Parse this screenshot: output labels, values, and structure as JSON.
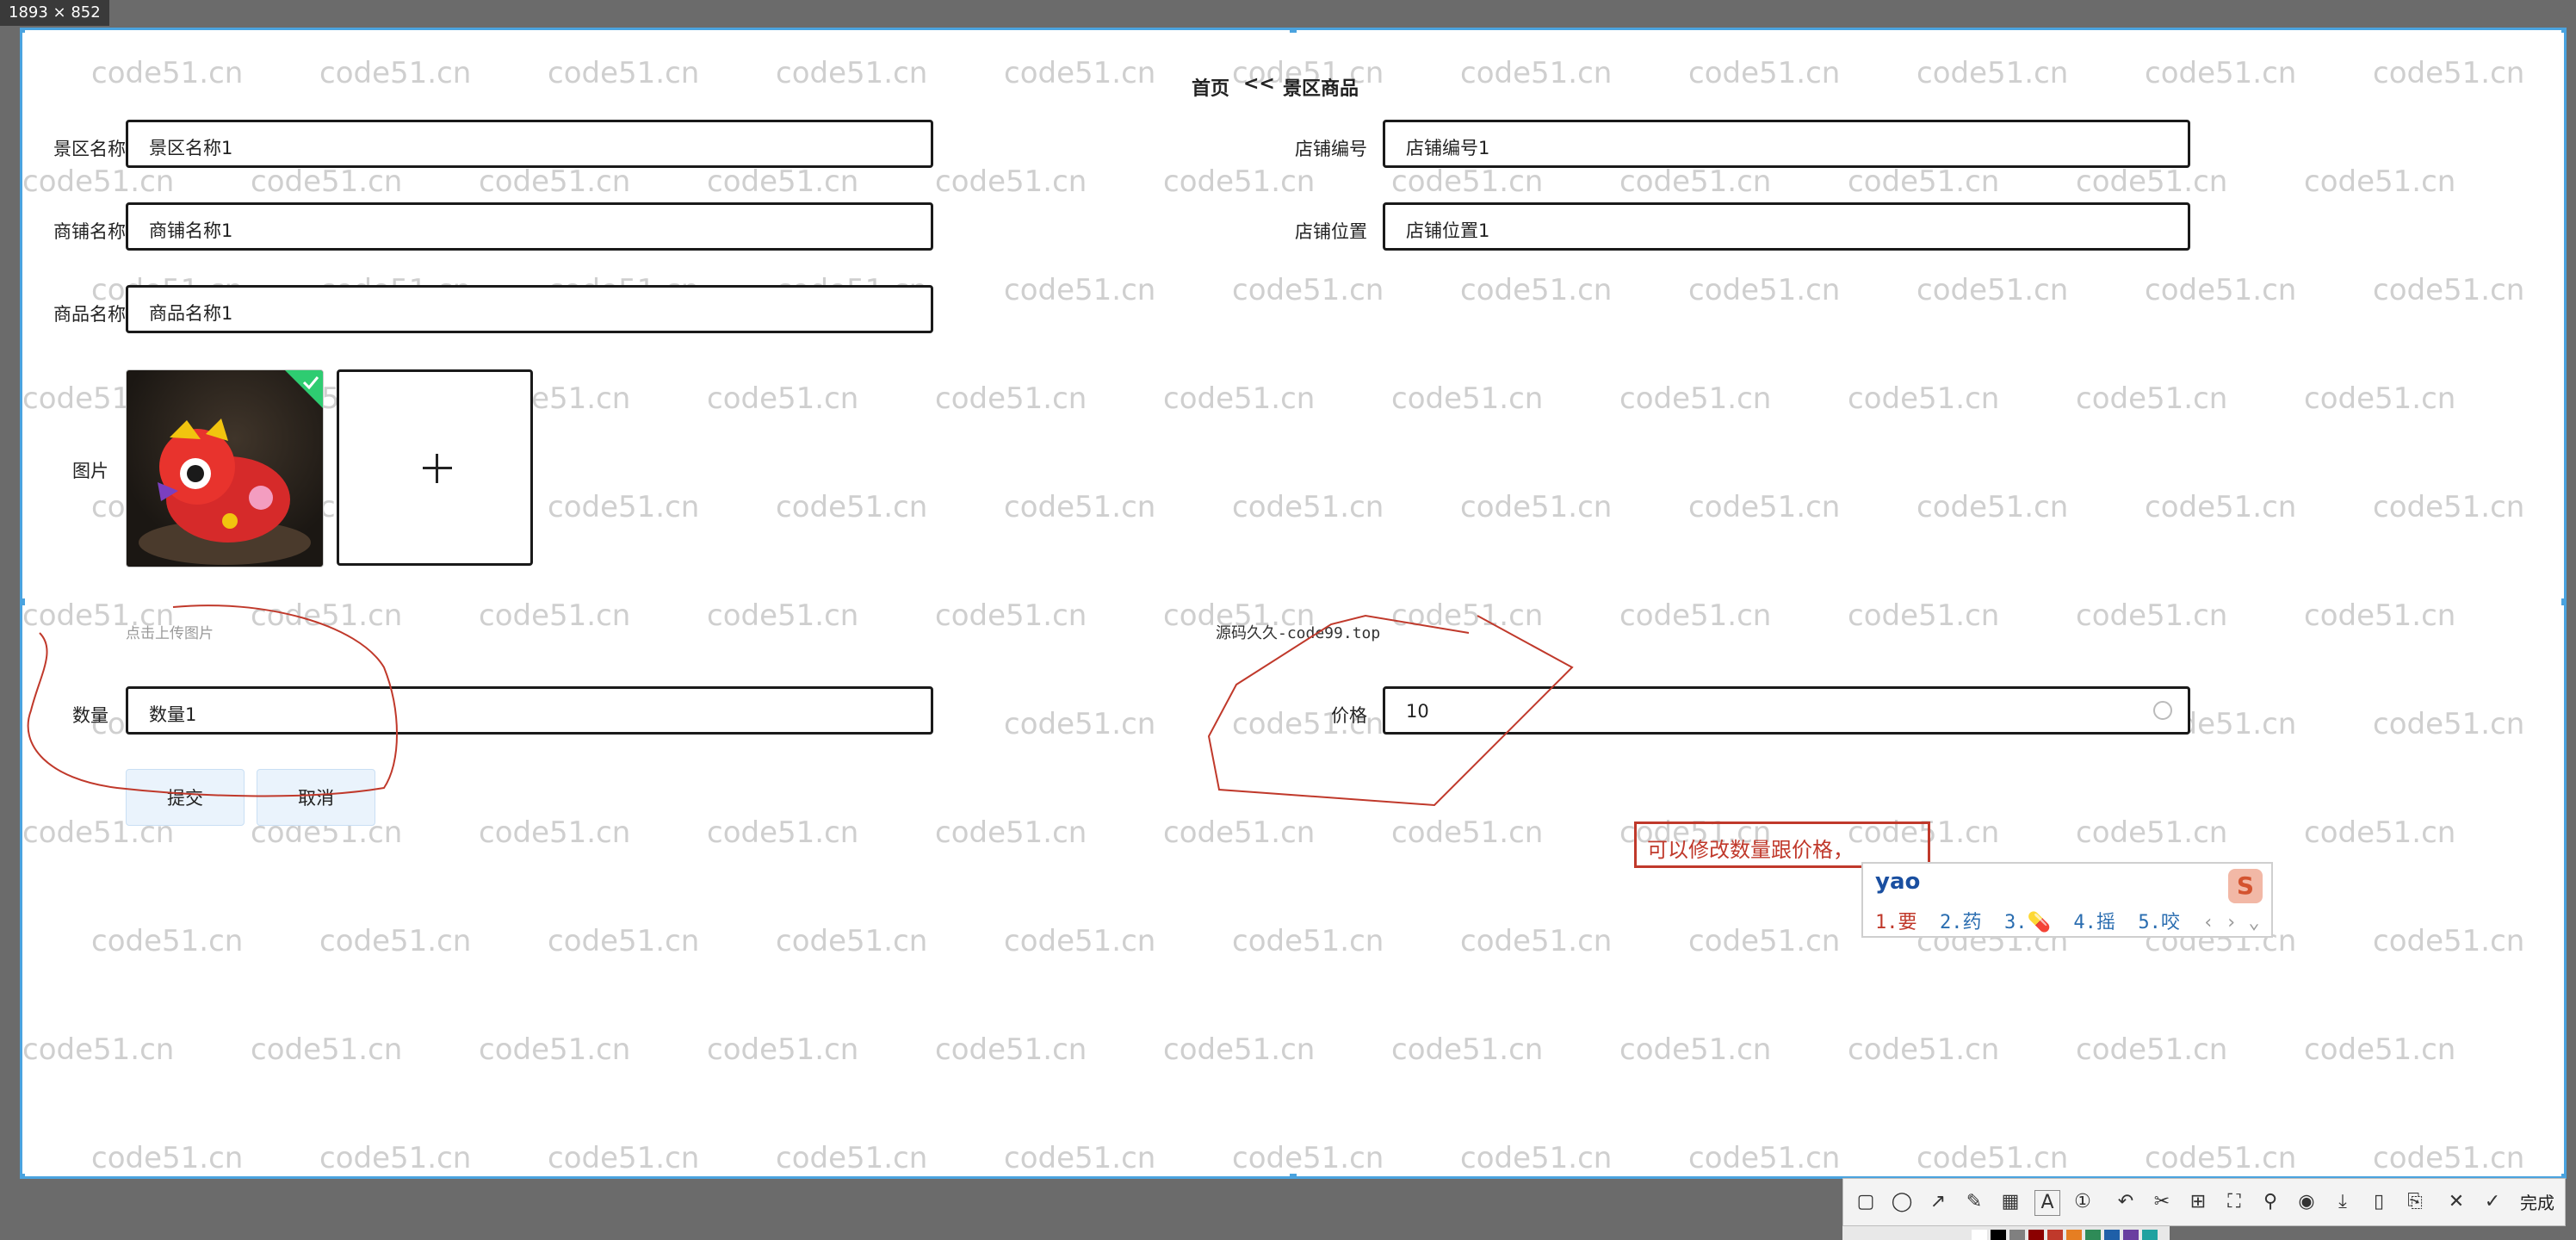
{
  "screenshot_tool": {
    "size_badge": "1893 × 852",
    "toolbar": {
      "icons": [
        "rectangle-icon",
        "ellipse-icon",
        "arrow-icon",
        "pen-icon",
        "mosaic-icon",
        "text-icon",
        "number-marker-icon",
        "undo-icon",
        "scissors-icon",
        "ocr-icon",
        "screenshot-icon",
        "pin-icon",
        "record-icon",
        "download-icon",
        "copy-icon",
        "save-icon",
        "close-icon",
        "check-icon"
      ],
      "finish_label": "完成"
    },
    "palette_colors": [
      "#ffffff",
      "#000000",
      "#808080",
      "#8b0000",
      "#c0392b",
      "#e67e22",
      "#2e8b57",
      "#1f5fa8",
      "#6a3fa0",
      "#1fa2a0"
    ]
  },
  "watermark": {
    "text": "code51.cn"
  },
  "breadcrumb": {
    "home": "首页",
    "separator": "<<",
    "current": "景区商品"
  },
  "form": {
    "fields": {
      "scenic_name": {
        "label": "景区名称",
        "value": "景区名称1"
      },
      "shop_no": {
        "label": "店铺编号",
        "value": "店铺编号1"
      },
      "shop_name": {
        "label": "商铺名称",
        "value": "商铺名称1"
      },
      "shop_location": {
        "label": "店铺位置",
        "value": "店铺位置1"
      },
      "product_name": {
        "label": "商品名称",
        "value": "商品名称1"
      },
      "image": {
        "label": "图片",
        "hint": "点击上传图片",
        "plus": "+"
      },
      "quantity": {
        "label": "数量",
        "value": "数量1"
      },
      "price": {
        "label": "价格",
        "value": "10"
      }
    },
    "buttons": {
      "submit": "提交",
      "cancel": "取消"
    }
  },
  "source_watermark": "源码久久-code99.top",
  "annotation": {
    "text": "可以修改数量跟价格，",
    "color": "#c0392b"
  },
  "ime": {
    "typed": "yao",
    "candidates": [
      "1.要",
      "2.药",
      "3.💊",
      "4.摇",
      "5.咬"
    ],
    "logo": "S"
  }
}
